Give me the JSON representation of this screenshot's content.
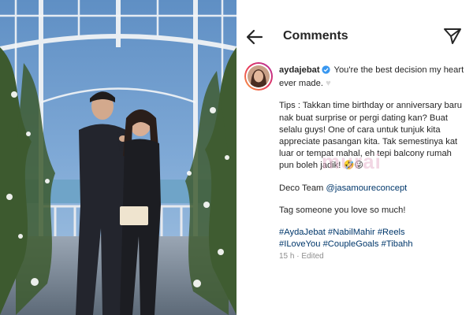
{
  "header": {
    "title": "Comments"
  },
  "comment": {
    "username": "aydajebat",
    "caption_line1": "You're the best decision my heart ever made.",
    "tips_text": "Tips : Takkan time birthday or anniversary baru nak buat surprise or pergi dating kan? Buat selalu guys! One of cara untuk tunjuk kita appreciate pasangan kita. Tak semestinya kat luar or tempat mahal, eh tepi balcony rumah pun boleh jadik!",
    "tips_emoji": "🤣😜",
    "deco_label": "Deco Team",
    "deco_tag": "@jasamoureconcept",
    "tag_line": "Tag someone you love so much!",
    "hashtags": [
      "#AydaJebat",
      "#NabilMahir",
      "#Reels",
      "#ILoveYou",
      "#CoupleGoals",
      "#Tibahh"
    ],
    "time": "15 h",
    "separator": "·",
    "edited": "Edited"
  },
  "watermark": "murai",
  "colors": {
    "text": "#262626",
    "hashtag": "#00376b",
    "meta": "#8e8e8e",
    "verified": "#3897f0"
  },
  "icons": {
    "back": "back-arrow-icon",
    "send": "send-icon",
    "verified": "verified-badge-icon",
    "heart": "white-heart-icon"
  }
}
